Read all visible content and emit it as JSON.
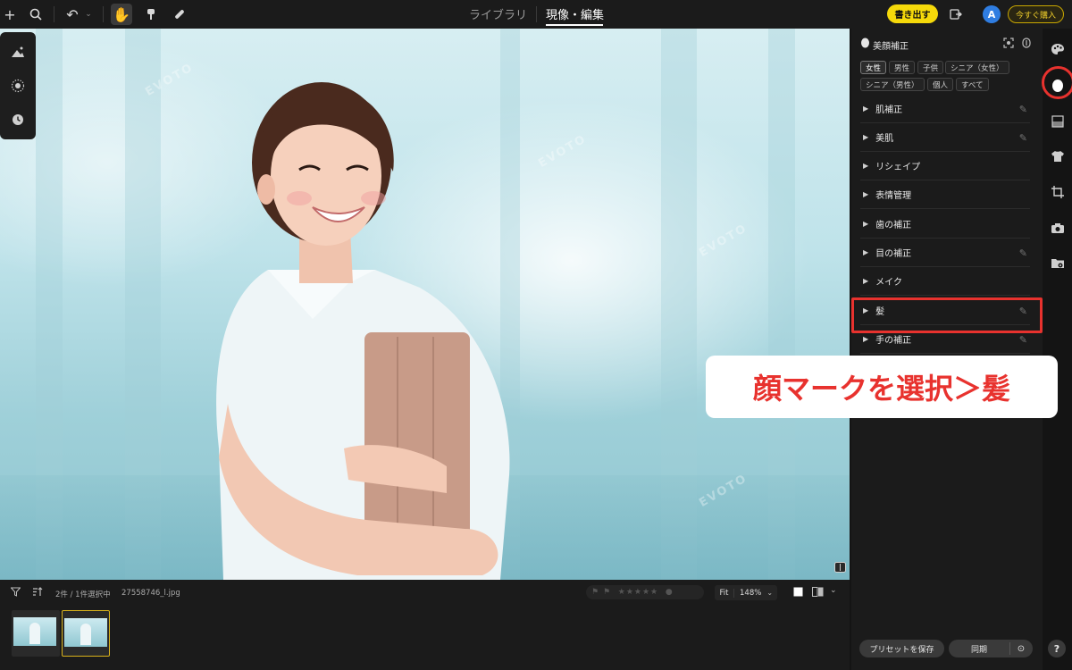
{
  "topbar": {
    "tabs": [
      {
        "label": "ライブラリ"
      },
      {
        "label": "現像・編集"
      }
    ],
    "export_label": "書き出す",
    "avatar_initial": "A",
    "buy_label": "今すぐ購入"
  },
  "canvas": {
    "watermark": "EVOTO"
  },
  "panel": {
    "title": "美顔補正",
    "chips": [
      "女性",
      "男性",
      "子供",
      "シニア（女性）",
      "シニア（男性）",
      "個人",
      "すべて"
    ],
    "selected_chip": "女性",
    "sections": [
      {
        "label": "肌補正",
        "has_edit": true
      },
      {
        "label": "美肌",
        "has_edit": true
      },
      {
        "label": "リシェイプ",
        "has_edit": false
      },
      {
        "label": "表情管理",
        "has_edit": false
      },
      {
        "label": "歯の補正",
        "has_edit": false
      },
      {
        "label": "目の補正",
        "has_edit": true
      },
      {
        "label": "メイク",
        "has_edit": false
      },
      {
        "label": "髪",
        "has_edit": true
      },
      {
        "label": "手の補正",
        "has_edit": true
      }
    ],
    "preset_label": "プリセットを保存",
    "sync_label": "同期",
    "highlight_color": "#e8322e"
  },
  "callout": {
    "text": "顔マークを選択＞髪"
  },
  "bottom": {
    "selection_text": "2件 / 1件選択中",
    "filename": "27558746_l.jpg",
    "fit_label": "Fit",
    "zoom": "148%"
  },
  "help_label": "?"
}
